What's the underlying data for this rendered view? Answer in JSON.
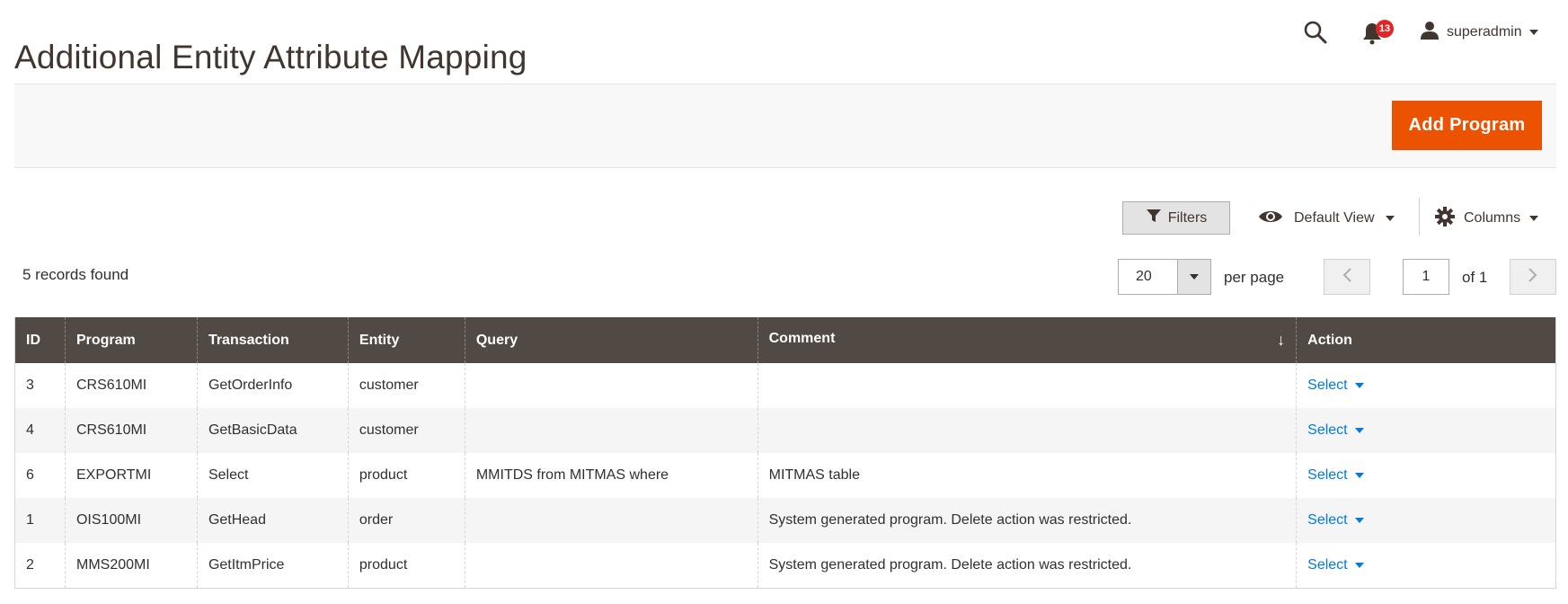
{
  "page": {
    "title": "Additional Entity Attribute Mapping"
  },
  "header": {
    "notifications_count": "13",
    "user_name": "superadmin"
  },
  "actions": {
    "add_label": "Add Program"
  },
  "toolbar": {
    "filters_label": "Filters",
    "view_label": "Default View",
    "columns_label": "Columns"
  },
  "grid_meta": {
    "records_found": "5 records found",
    "per_page_value": "20",
    "per_page_label": "per page",
    "current_page": "1",
    "of_pages": "of 1"
  },
  "colors": {
    "accent": "#eb5202",
    "header_bg": "#514943",
    "link": "#007bdb",
    "badge": "#e22626"
  },
  "table": {
    "columns": [
      "ID",
      "Program",
      "Transaction",
      "Entity",
      "Query",
      "Comment",
      "Action"
    ],
    "sort_indicator": "↓",
    "rows": [
      {
        "id": "3",
        "program": "CRS610MI",
        "transaction": "GetOrderInfo",
        "entity": "customer",
        "query": "",
        "comment": "",
        "action": "Select"
      },
      {
        "id": "4",
        "program": "CRS610MI",
        "transaction": "GetBasicData",
        "entity": "customer",
        "query": "",
        "comment": "",
        "action": "Select"
      },
      {
        "id": "6",
        "program": "EXPORTMI",
        "transaction": "Select",
        "entity": "product",
        "query": "MMITDS from MITMAS where",
        "comment": "MITMAS table",
        "action": "Select"
      },
      {
        "id": "1",
        "program": "OIS100MI",
        "transaction": "GetHead",
        "entity": "order",
        "query": "",
        "comment": "System generated program. Delete action was restricted.",
        "action": "Select"
      },
      {
        "id": "2",
        "program": "MMS200MI",
        "transaction": "GetItmPrice",
        "entity": "product",
        "query": "",
        "comment": "System generated program. Delete action was restricted.",
        "action": "Select"
      }
    ]
  },
  "icons": {
    "search": "search-icon",
    "bell": "bell-icon",
    "user": "user-icon",
    "filter": "filter-icon",
    "eye": "eye-icon",
    "gear": "gear-icon",
    "prev": "chevron-left-icon",
    "next": "chevron-right-icon"
  }
}
